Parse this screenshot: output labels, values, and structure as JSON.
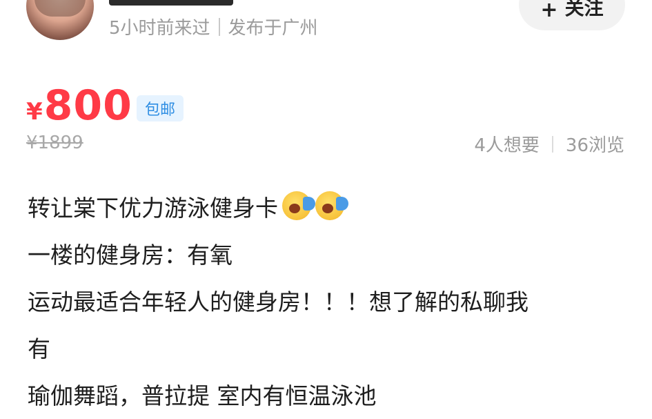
{
  "header": {
    "last_seen": "5小时前来过",
    "location": "发布于广州",
    "follow_label": "关注",
    "follow_icon": "plus-icon"
  },
  "price": {
    "symbol": "¥",
    "value": "800",
    "badge": "包邮",
    "original": "¥1899"
  },
  "stats": {
    "wants": "4人想要",
    "views": "36浏览"
  },
  "description": {
    "lines": [
      "转让棠下优力游泳健身卡",
      "一楼的健身房：有氧",
      "运动最适合年轻人的健身房！！！想了解的私聊我",
      "有",
      "瑜伽舞蹈，普拉提 室内有恒温泳池"
    ],
    "emoji": "screaming-megaphone-emoji"
  },
  "colors": {
    "price": "#ff3a46",
    "badge_bg": "#e6f3ff",
    "badge_text": "#2f8ee3",
    "muted": "#9b9b9b"
  }
}
